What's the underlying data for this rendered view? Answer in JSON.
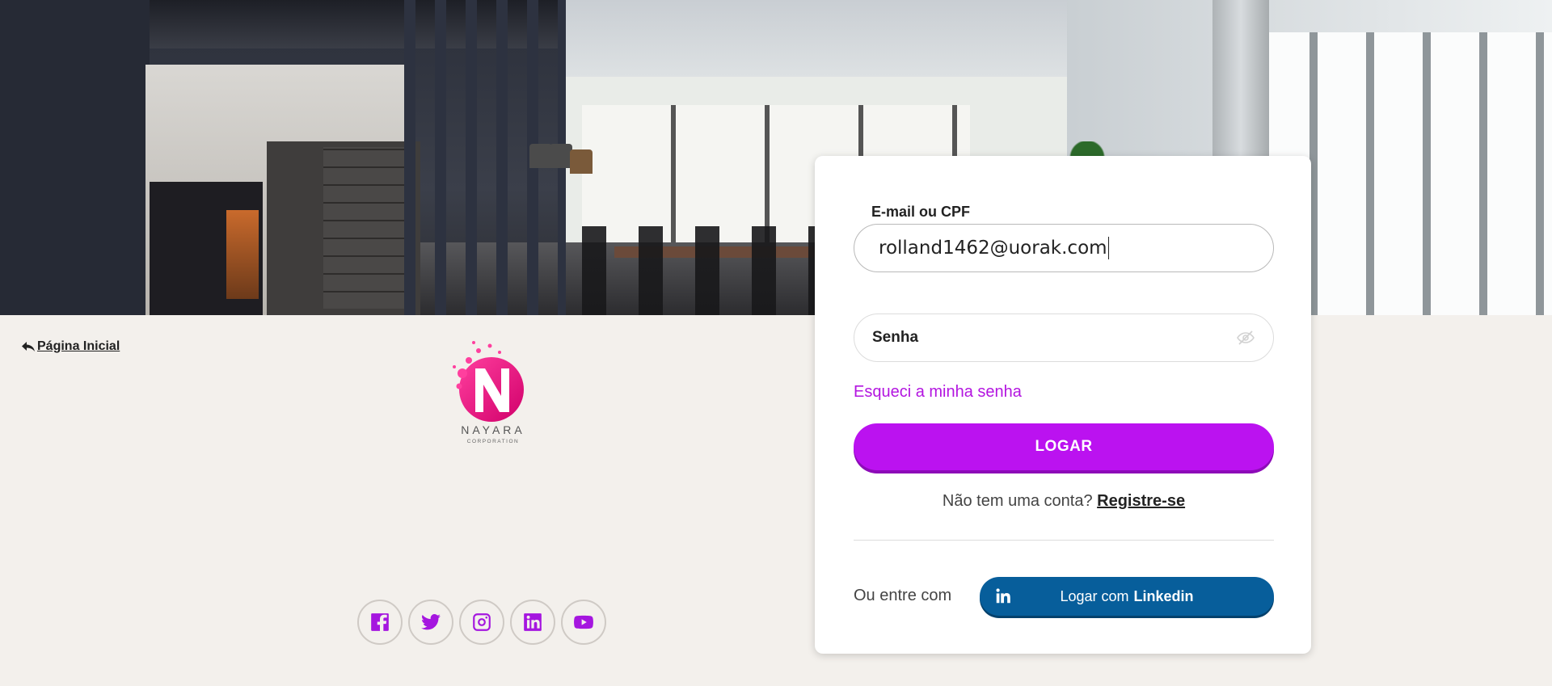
{
  "nav": {
    "home_label": "Página Inicial"
  },
  "logo": {
    "word": "NAYARA",
    "sub": "CORPORATION",
    "letter": "N"
  },
  "login": {
    "email_label": "E-mail ou CPF",
    "email_value": "rolland1462@uorak.com",
    "password_placeholder": "Senha",
    "forgot_label": "Esqueci a minha senha",
    "submit_label": "LOGAR",
    "signup_prefix": "Não tem uma conta?",
    "signup_link": "Registre-se",
    "alt_prefix": "Ou entre com",
    "linkedin_label": "Logar com",
    "linkedin_brand": "Linkedin"
  },
  "social": [
    "facebook-icon",
    "twitter-icon",
    "instagram-icon",
    "linkedin-icon",
    "youtube-icon"
  ],
  "colors": {
    "accent": "#bb12f0",
    "linkedin": "#075e9b",
    "background": "#f3f0ec",
    "icon": "#a516df"
  }
}
